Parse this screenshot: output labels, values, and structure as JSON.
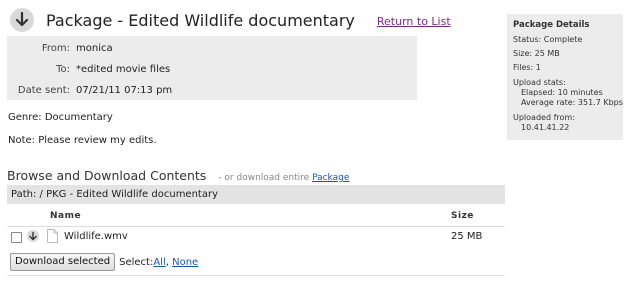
{
  "header": {
    "title": "Package - Edited Wildlife documentary",
    "return_link": "Return to List"
  },
  "meta": {
    "from_label": "From:",
    "from_value": "monica",
    "to_label": "To:",
    "to_value": "*edited movie files",
    "date_label": "Date sent:",
    "date_value": "07/21/11 07:13 pm"
  },
  "genre": "Genre: Documentary",
  "note": "Note: Please review my edits.",
  "browse": {
    "title": "Browse and Download Contents",
    "sub_prefix": "- or download entire",
    "sub_link": "Package",
    "path": "Path: / PKG - Edited Wildlife documentary"
  },
  "table": {
    "columns": [
      "Name",
      "Size"
    ],
    "rows": [
      {
        "name": "Wildlife.wmv",
        "size": "25 MB",
        "checked": false
      }
    ]
  },
  "actions": {
    "download_button": "Download selected",
    "select_label": "Select:",
    "select_all": "All",
    "select_none": "None"
  },
  "details": {
    "title": "Package Details",
    "status": "Status: Complete",
    "size": "Size: 25 MB",
    "files": "Files: 1",
    "upload_stats": "Upload stats:",
    "elapsed": "Elapsed: 10 minutes",
    "avg_rate": "Average rate: 351.7 Kbps",
    "uploaded_from": "Uploaded from:",
    "ip": "10.41.41.22"
  },
  "colors": {
    "link_visited": "#7a2a8c",
    "link": "#1a55b5",
    "panel_bg": "#ececec"
  },
  "icons": [
    "down-arrow-icon",
    "document-icon",
    "checkbox"
  ]
}
